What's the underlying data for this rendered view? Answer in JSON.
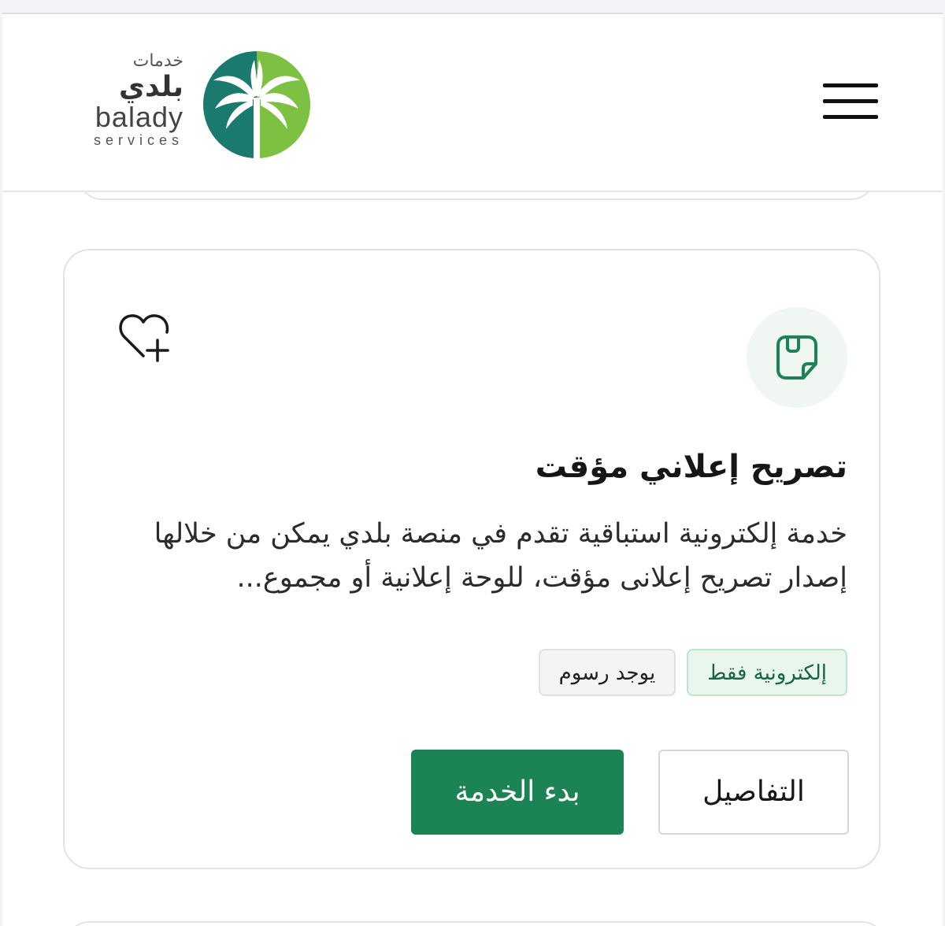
{
  "header": {
    "logo": {
      "arabic_small": "خدمات",
      "arabic_big": "بلدي",
      "english": "balady",
      "english_small": "services"
    },
    "menu_icon": "hamburger-menu-icon"
  },
  "card": {
    "service_icon": "document-note-icon",
    "favorite_icon": "heart-plus-icon",
    "title": "تصريح إعلاني مؤقت",
    "description": "خدمة إلكترونية استباقية تقدم في منصة بلدي يمكن من خلالها إصدار تصريح إعلانى مؤقت، للوحة إعلانية أو مجموع...",
    "tags": [
      {
        "label": "إلكترونية فقط"
      },
      {
        "label": "يوجد رسوم"
      }
    ],
    "buttons": {
      "details": "التفاصيل",
      "start": "بدء الخدمة"
    }
  },
  "colors": {
    "primary_green": "#1b8354",
    "tag_green_bg": "#e8f6ee",
    "logo_teal": "#1b7a6e",
    "logo_lime": "#7cc142"
  }
}
